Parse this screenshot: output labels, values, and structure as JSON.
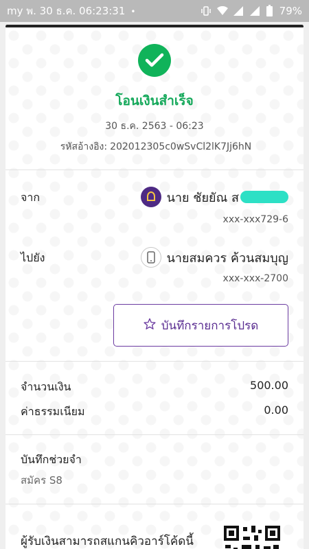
{
  "status_bar": {
    "left_text": "my พ. 30 ธ.ค. 06:23:31",
    "dot": "•",
    "battery": "79%"
  },
  "receipt": {
    "title": "โอนเงินสำเร็จ",
    "datetime": "30 ธ.ค. 2563 - 06:23",
    "ref_label": "รหัสอ้างอิง:",
    "ref_value": "202012305c0wSvCl2lK7Jj6hN",
    "from": {
      "label": "จาก",
      "name": "นาย ชัยยัณ ส",
      "account": "xxx-xxx729-6"
    },
    "to": {
      "label": "ไปยัง",
      "name": "นายสมควร  ค้วนสมบุญ",
      "account": "xxx-xxx-2700"
    },
    "favorite_button": "บันทึกรายการโปรด",
    "amount": {
      "label": "จำนวนเงิน",
      "value": "500.00"
    },
    "fee": {
      "label": "ค่าธรรมเนียม",
      "value": "0.00"
    },
    "memo": {
      "label": "บันทึกช่วยจำ",
      "value": "สมัคร S8"
    },
    "qr_text": "ผู้รับเงินสามารถสแกนคิวอาร์โค้ดนี้"
  },
  "colors": {
    "success": "#10b35a",
    "accent": "#5a2d91",
    "status_bar": "#b9b9b9"
  }
}
